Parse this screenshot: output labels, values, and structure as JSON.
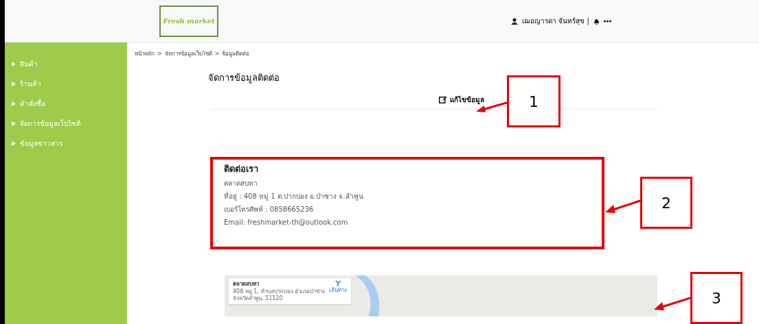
{
  "header": {
    "logo": "Fresh market",
    "user_name": "เฌอญารดา จันทร์สุข |"
  },
  "sidebar": {
    "items": [
      {
        "label": "สินค้า"
      },
      {
        "label": "ร้านค้า"
      },
      {
        "label": "คำสั่งซื้อ"
      },
      {
        "label": "จัดการข้อมูลเว็บไซต์"
      },
      {
        "label": "ข้อมูลข่าวสาร"
      }
    ]
  },
  "breadcrumb": [
    "หน้าหลัก",
    "จัดการข้อมูลเว็บไซต์",
    "ข้อมูลติดต่อ"
  ],
  "breadcrumb_separator": ">",
  "page_title": "จัดการข้อมูลติดต่อ",
  "edit_button": "แก้ไขข้อมูล",
  "contact": {
    "heading": "ติดต่อเรา",
    "lines": [
      "ตลาดสบทา",
      "ที่อยู่ : 408 หมู่ 1 ต.ปากบ่อง อ.ป่าซาง จ.ลำพูน",
      "เบอร์โทรศัพท์ : 0858665236",
      "Email: freshmarket-th@outlook.com"
    ]
  },
  "map_card": {
    "title": "ตลาดสบทา",
    "address": "408 หมู่ 1, ตำบลปากบ่อง อำเภอป่าซาง จังหวัดลำพูน, 51120",
    "directions": "เส้นทาง"
  },
  "callouts": [
    "1",
    "2",
    "3"
  ]
}
